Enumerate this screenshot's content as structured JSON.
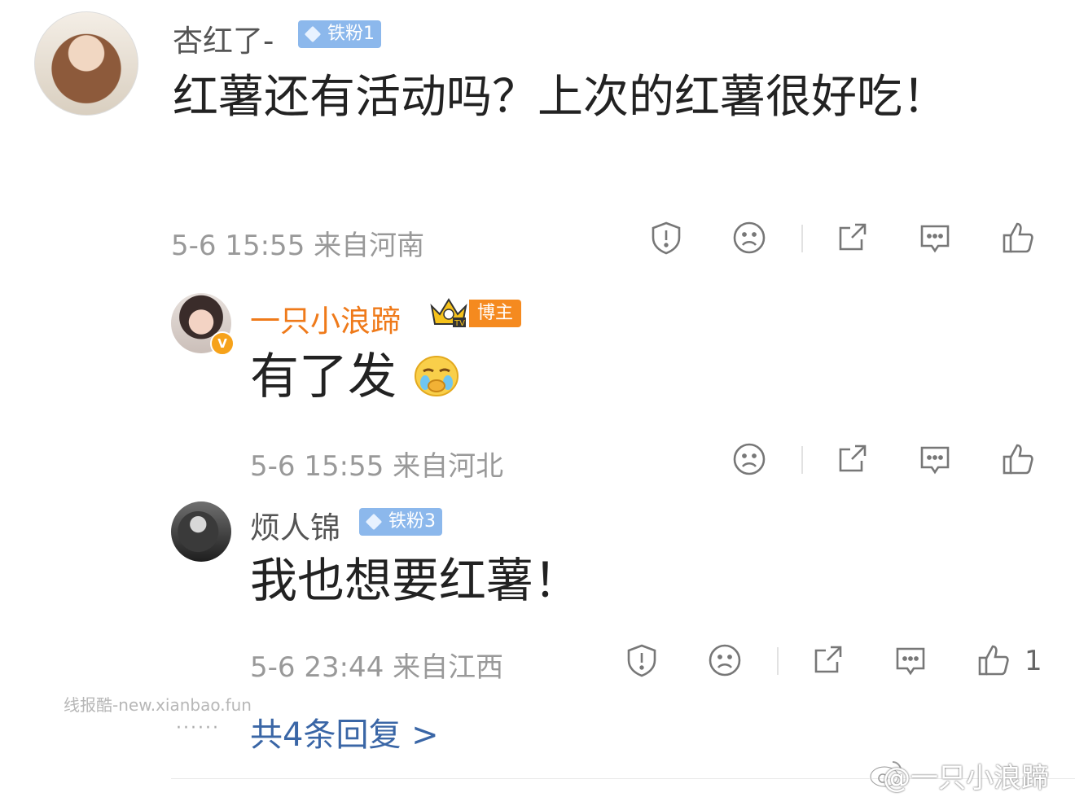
{
  "comments": [
    {
      "user": "杏红了-",
      "badge": "铁粉1",
      "text": "红薯还有活动吗？上次的红薯很好吃！",
      "meta": "5-6 15:55 来自河南"
    },
    {
      "user": "一只小浪蹄",
      "badge": "博主",
      "text": "有了发",
      "meta": "5-6 15:55 来自河北",
      "verified": "V"
    },
    {
      "user": "烦人锦",
      "badge": "铁粉3",
      "text": "我也想要红薯！",
      "meta": "5-6 23:44 来自江西",
      "like_count": "1"
    }
  ],
  "footer": {
    "dots": "······",
    "more_replies": "共4条回复 >",
    "watermark": "线报酷-new.xianbao.fun",
    "brand": "@一只小浪蹄"
  },
  "colors": {
    "owner_name": "#ef7a1a",
    "fan_badge": "#8cb8ec",
    "owner_badge": "#f58a1f",
    "link": "#3a66a6"
  },
  "icons": [
    "report-icon",
    "dislike-icon",
    "share-icon",
    "reply-icon",
    "like-icon"
  ]
}
